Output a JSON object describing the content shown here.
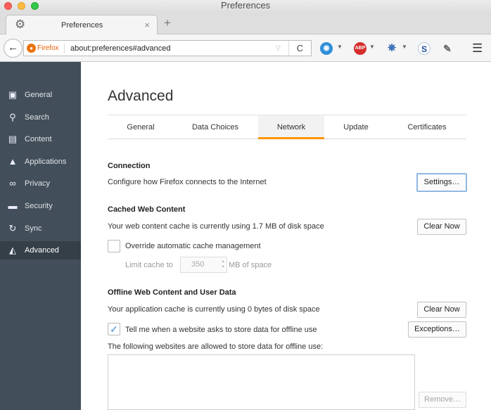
{
  "window": {
    "title": "Preferences"
  },
  "tab": {
    "label": "Preferences",
    "icon": "gear-icon",
    "close_glyph": "×",
    "new_tab_glyph": "+"
  },
  "navbar": {
    "identity_label": "Firefox",
    "url": "about:preferences#advanced",
    "reload_glyph": "C",
    "back_glyph": "←",
    "addons": [
      {
        "name": "globe-addon-icon",
        "glyph": "◉",
        "color": "#2f8fd8"
      },
      {
        "name": "adblock-plus-icon",
        "glyph": "ABP",
        "color": "#d62c2c"
      },
      {
        "name": "satellite-addon-icon",
        "glyph": "✵",
        "color": "#3d72b8"
      },
      {
        "name": "s-addon-icon",
        "glyph": "S",
        "color": "#1a4c99"
      },
      {
        "name": "pen-addon-icon",
        "glyph": "✎",
        "color": "#666666"
      }
    ],
    "menu_glyph": "☰"
  },
  "sidebar": {
    "background": "#424f5a",
    "items": [
      {
        "label": "General",
        "icon": "general-icon",
        "glyph": "▣"
      },
      {
        "label": "Search",
        "icon": "search-icon",
        "glyph": "⚲"
      },
      {
        "label": "Content",
        "icon": "content-icon",
        "glyph": "▤"
      },
      {
        "label": "Applications",
        "icon": "rocket-icon",
        "glyph": "▲"
      },
      {
        "label": "Privacy",
        "icon": "mask-icon",
        "glyph": "∞"
      },
      {
        "label": "Security",
        "icon": "lock-icon",
        "glyph": "▬"
      },
      {
        "label": "Sync",
        "icon": "sync-icon",
        "glyph": "↻"
      },
      {
        "label": "Advanced",
        "icon": "wizard-hat-icon",
        "glyph": "◭"
      }
    ],
    "selected": "Advanced"
  },
  "main": {
    "title": "Advanced",
    "tabs": [
      "General",
      "Data Choices",
      "Network",
      "Update",
      "Certificates"
    ],
    "selected_tab": "Network",
    "accent_color": "#ff9500",
    "connection": {
      "heading": "Connection",
      "description": "Configure how Firefox connects to the Internet",
      "button": "Settings…"
    },
    "cache": {
      "heading": "Cached Web Content",
      "description": "Your web content cache is currently using 1.7 MB of disk space",
      "button": "Clear Now",
      "override_label": "Override automatic cache management",
      "override_checked": false,
      "limit_label": "Limit cache to",
      "limit_value": "350",
      "limit_unit": "MB of space"
    },
    "offline": {
      "heading": "Offline Web Content and User Data",
      "description": "Your application cache is currently using 0 bytes of disk space",
      "button": "Clear Now",
      "tell_me_label": "Tell me when a website asks to store data for offline use",
      "tell_me_checked": true,
      "check_glyph": "✓",
      "exceptions_button": "Exceptions…",
      "allowed_label": "The following websites are allowed to store data for offline use:",
      "remove_button": "Remove…"
    }
  }
}
